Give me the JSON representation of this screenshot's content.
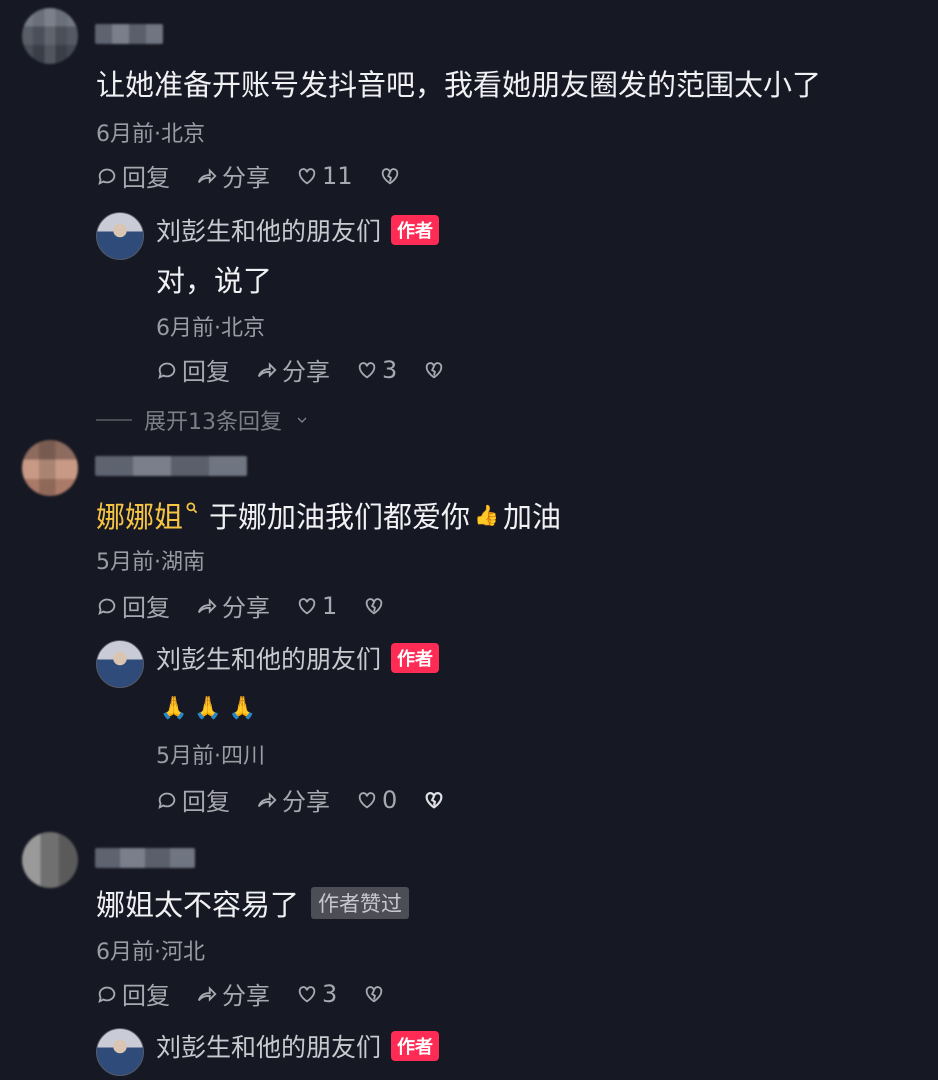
{
  "comments": [
    {
      "text": "让她准备开账号发抖音吧，我看她朋友圈发的范围太小了",
      "meta": "6月前·北京",
      "reply": "回复",
      "share": "分享",
      "likes": "11",
      "expand": "展开13条回复",
      "author_reply": {
        "name": "刘彭生和他的朋友们",
        "badge": "作者",
        "text": "对，说了",
        "meta": "6月前·北京",
        "reply": "回复",
        "share": "分享",
        "likes": "3"
      }
    },
    {
      "mention": "娜娜姐",
      "text": "于娜加油我们都爱你",
      "emoji": "👍",
      "text_suffix": "加油",
      "meta": "5月前·湖南",
      "reply": "回复",
      "share": "分享",
      "likes": "1",
      "author_reply": {
        "name": "刘彭生和他的朋友们",
        "badge": "作者",
        "text": "🙏 🙏 🙏",
        "meta": "5月前·四川",
        "reply": "回复",
        "share": "分享",
        "likes": "0"
      }
    },
    {
      "text": "娜姐太不容易了",
      "liked_badge": "作者赞过",
      "meta": "6月前·河北",
      "reply": "回复",
      "share": "分享",
      "likes": "3",
      "author_reply": {
        "name": "刘彭生和他的朋友们",
        "badge": "作者"
      }
    }
  ],
  "icons": [
    "comment-bubble-icon",
    "share-arrow-icon",
    "heart-icon",
    "dislike-heart-icon",
    "search-icon",
    "chevron-down-icon"
  ],
  "colors": {
    "background": "#161823",
    "author_badge": "#fe2c55",
    "mention": "#f6c443"
  }
}
